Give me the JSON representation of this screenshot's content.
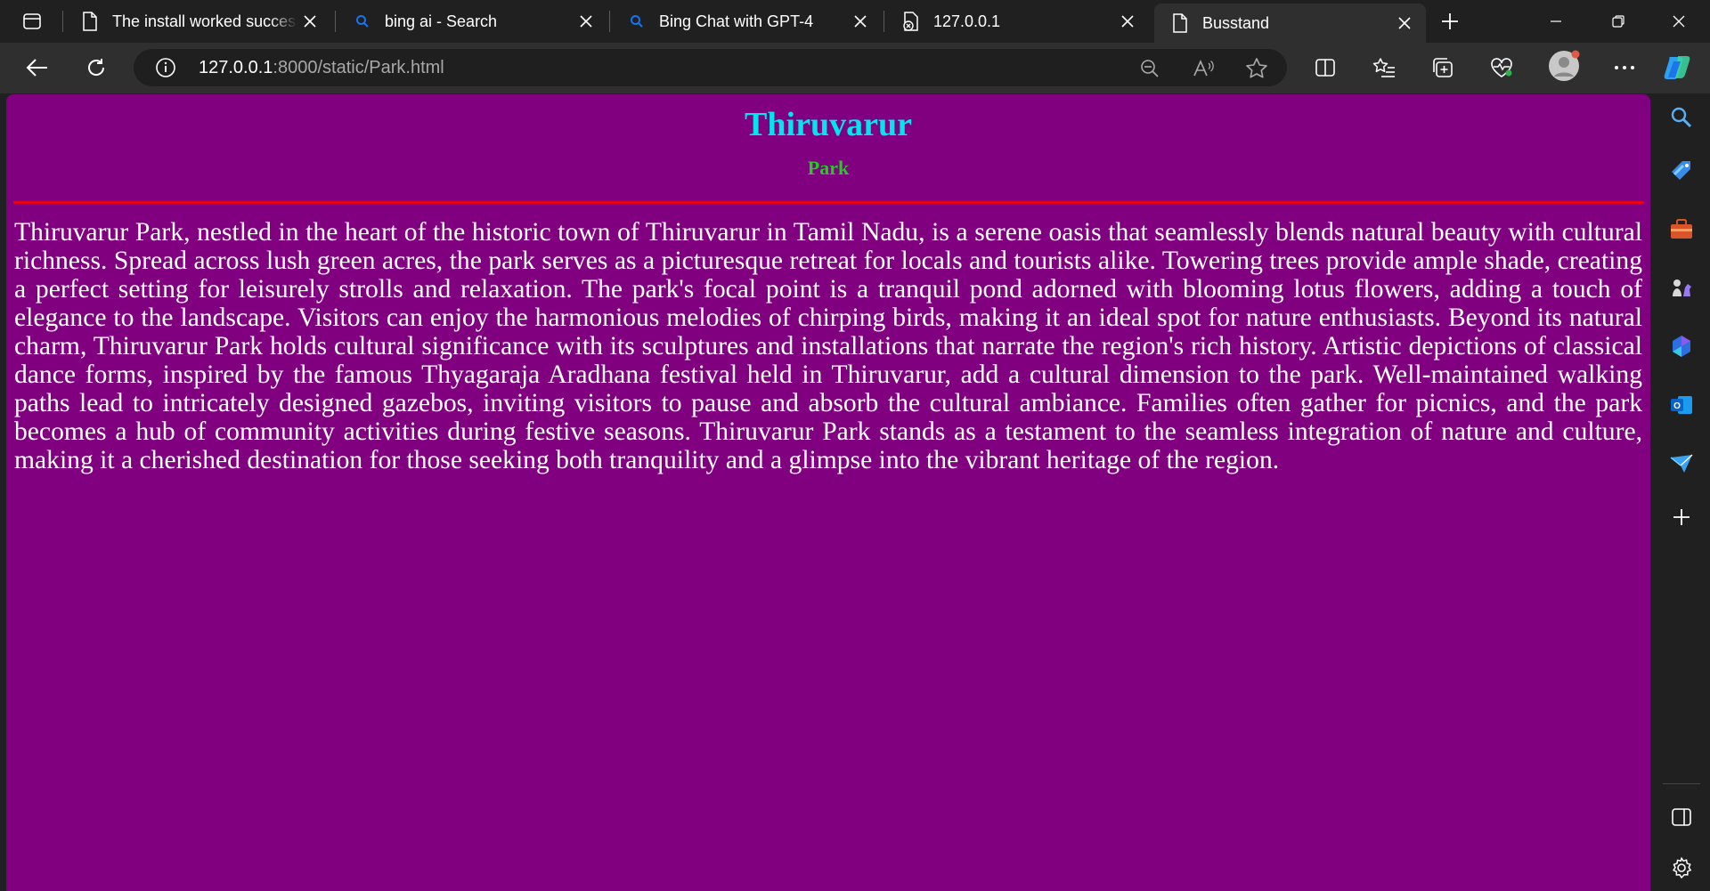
{
  "browser": {
    "tabs": [
      {
        "title": "The install worked successfully! Congratulations!",
        "favicon": "page-icon",
        "active": false
      },
      {
        "title": "bing ai - Search",
        "favicon": "search-icon",
        "active": false
      },
      {
        "title": "Bing Chat with GPT-4",
        "favicon": "search-icon",
        "active": false
      },
      {
        "title": "127.0.0.1",
        "favicon": "broken-page-icon",
        "active": false
      },
      {
        "title": "Busstand",
        "favicon": "page-icon",
        "active": true
      }
    ],
    "address": {
      "host": "127.0.0.1",
      "rest": ":8000/static/Park.html"
    },
    "colors": {
      "chrome_dark": "#202020",
      "toolbar": "#2f2f2f",
      "accent": "#1a73e8"
    }
  },
  "sidebar": {
    "icons": [
      "search-icon",
      "tag-icon",
      "briefcase-icon",
      "chess-icon",
      "copilot-icon",
      "outlook-icon",
      "send-icon",
      "add-icon",
      "sidebar-toggle-icon",
      "settings-icon"
    ]
  },
  "page": {
    "heading": "Thiruvarur",
    "subheading": "Park",
    "body": "Thiruvarur Park, nestled in the heart of the historic town of Thiruvarur in Tamil Nadu, is a serene oasis that seamlessly blends natural beauty with cultural richness. Spread across lush green acres, the park serves as a picturesque retreat for locals and tourists alike. Towering trees provide ample shade, creating a perfect setting for leisurely strolls and relaxation. The park's focal point is a tranquil pond adorned with blooming lotus flowers, adding a touch of elegance to the landscape. Visitors can enjoy the harmonious melodies of chirping birds, making it an ideal spot for nature enthusiasts. Beyond its natural charm, Thiruvarur Park holds cultural significance with its sculptures and installations that narrate the region's rich history. Artistic depictions of classical dance forms, inspired by the famous Thyagaraja Aradhana festival held in Thiruvarur, add a cultural dimension to the park. Well-maintained walking paths lead to intricately designed gazebos, inviting visitors to pause and absorb the cultural ambiance. Families often gather for picnics, and the park becomes a hub of community activities during festive seasons. Thiruvarur Park stands as a testament to the seamless integration of nature and culture, making it a cherished destination for those seeking both tranquility and a glimpse into the vibrant heritage of the region.",
    "colors": {
      "background": "#800080",
      "heading": "#00e5ee",
      "subheading": "#22cc22",
      "rule": "#e8001a",
      "text": "#ffffff"
    }
  }
}
